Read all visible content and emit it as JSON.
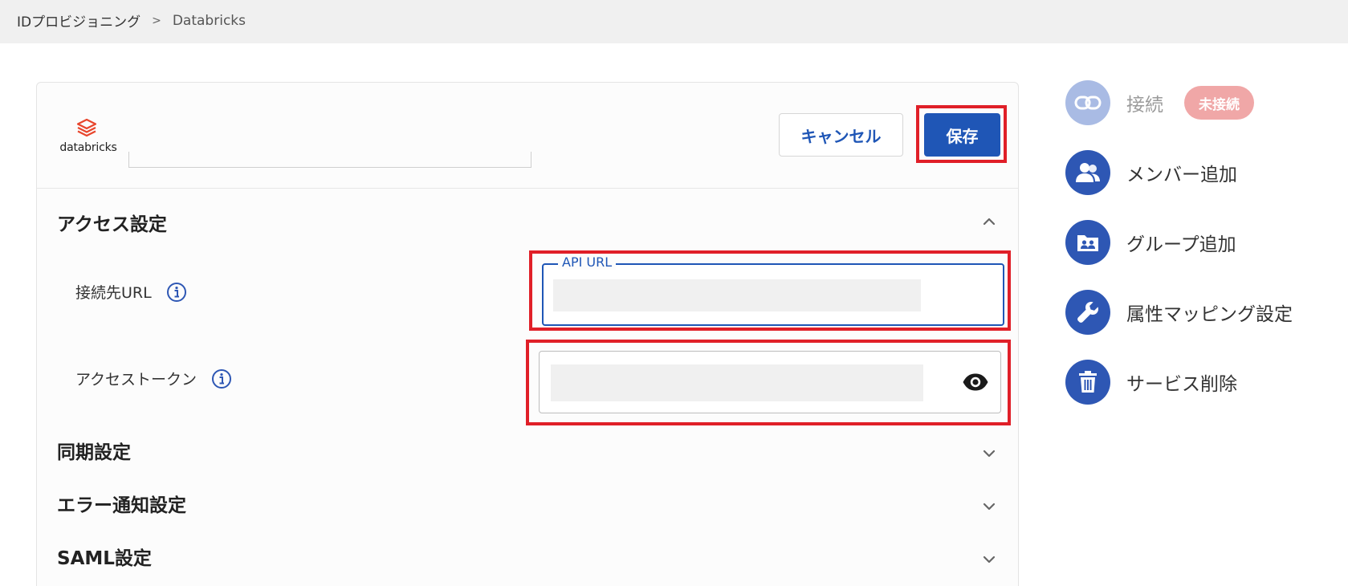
{
  "breadcrumb": {
    "root": "IDプロビジョニング",
    "separator": ">",
    "current": "Databricks"
  },
  "service": {
    "logo_text": "databricks",
    "logo_icon": "databricks-logo-icon"
  },
  "header": {
    "cancel_label": "キャンセル",
    "save_label": "保存"
  },
  "sections": {
    "access": {
      "title": "アクセス設定",
      "expanded": true
    },
    "sync": {
      "title": "同期設定"
    },
    "error_notify": {
      "title": "エラー通知設定"
    },
    "saml": {
      "title": "SAML設定"
    }
  },
  "access_fields": {
    "url": {
      "label": "接続先URL",
      "input_label": "API URL",
      "value": ""
    },
    "token": {
      "label": "アクセストークン",
      "value": "",
      "visibility_icon": "eye-icon"
    }
  },
  "sidebar": {
    "items": [
      {
        "label": "接続",
        "icon": "link-icon",
        "badge": "未接続",
        "enabled": false
      },
      {
        "label": "メンバー追加",
        "icon": "people-icon"
      },
      {
        "label": "グループ追加",
        "icon": "group-folder-icon"
      },
      {
        "label": "属性マッピング設定",
        "icon": "wrench-icon"
      },
      {
        "label": "サービス削除",
        "icon": "trash-icon"
      }
    ]
  },
  "colors": {
    "primary": "#1f56b6",
    "highlight": "#e01f28",
    "badge": "#f0a7a7",
    "sidebar_icon": "#2e57b4"
  }
}
